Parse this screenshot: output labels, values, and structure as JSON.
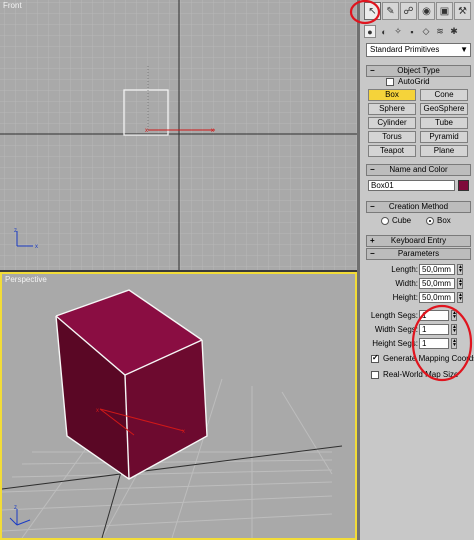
{
  "viewports": {
    "front": {
      "label": "Front"
    },
    "perspective": {
      "label": "Perspective"
    }
  },
  "colors": {
    "box_color": "#7e0b3a",
    "annotation": "#e0141e",
    "active_viewport_border": "#f2dc38",
    "active_button": "#f5d33a"
  },
  "command_panel": {
    "tabs": [
      {
        "icon": "create-arrow-icon",
        "active": true
      },
      {
        "icon": "modify-icon"
      },
      {
        "icon": "hierarchy-icon"
      },
      {
        "icon": "motion-icon"
      },
      {
        "icon": "display-icon"
      },
      {
        "icon": "utilities-hammer-icon"
      }
    ],
    "subtabs": [
      "geometry-icon",
      "shapes-icon",
      "lights-icon",
      "cameras-icon",
      "helpers-icon",
      "spacewarps-icon",
      "systems-icon"
    ],
    "category_dropdown": "Standard Primitives",
    "object_type": {
      "title": "Object Type",
      "autogrid_label": "AutoGrid",
      "autogrid_checked": false,
      "buttons": [
        "Box",
        "Cone",
        "Sphere",
        "GeoSphere",
        "Cylinder",
        "Tube",
        "Torus",
        "Pyramid",
        "Teapot",
        "Plane"
      ],
      "active_button": "Box"
    },
    "name_and_color": {
      "title": "Name and Color",
      "name_value": "Box01"
    },
    "creation_method": {
      "title": "Creation Method",
      "options": [
        "Cube",
        "Box"
      ],
      "selected": "Box"
    },
    "keyboard_entry": {
      "title": "Keyboard Entry"
    },
    "parameters": {
      "title": "Parameters",
      "length_label": "Length:",
      "length_value": "50,0mm",
      "width_label": "Width:",
      "width_value": "50,0mm",
      "height_label": "Height:",
      "height_value": "50,0mm",
      "length_segs_label": "Length Segs:",
      "length_segs_value": "1",
      "width_segs_label": "Width Segs:",
      "width_segs_value": "1",
      "height_segs_label": "Height Segs:",
      "height_segs_value": "1",
      "gen_mapping_label": "Generate Mapping Coords.",
      "gen_mapping_checked": true,
      "real_world_label": "Real-World Map Size",
      "real_world_checked": false
    }
  }
}
